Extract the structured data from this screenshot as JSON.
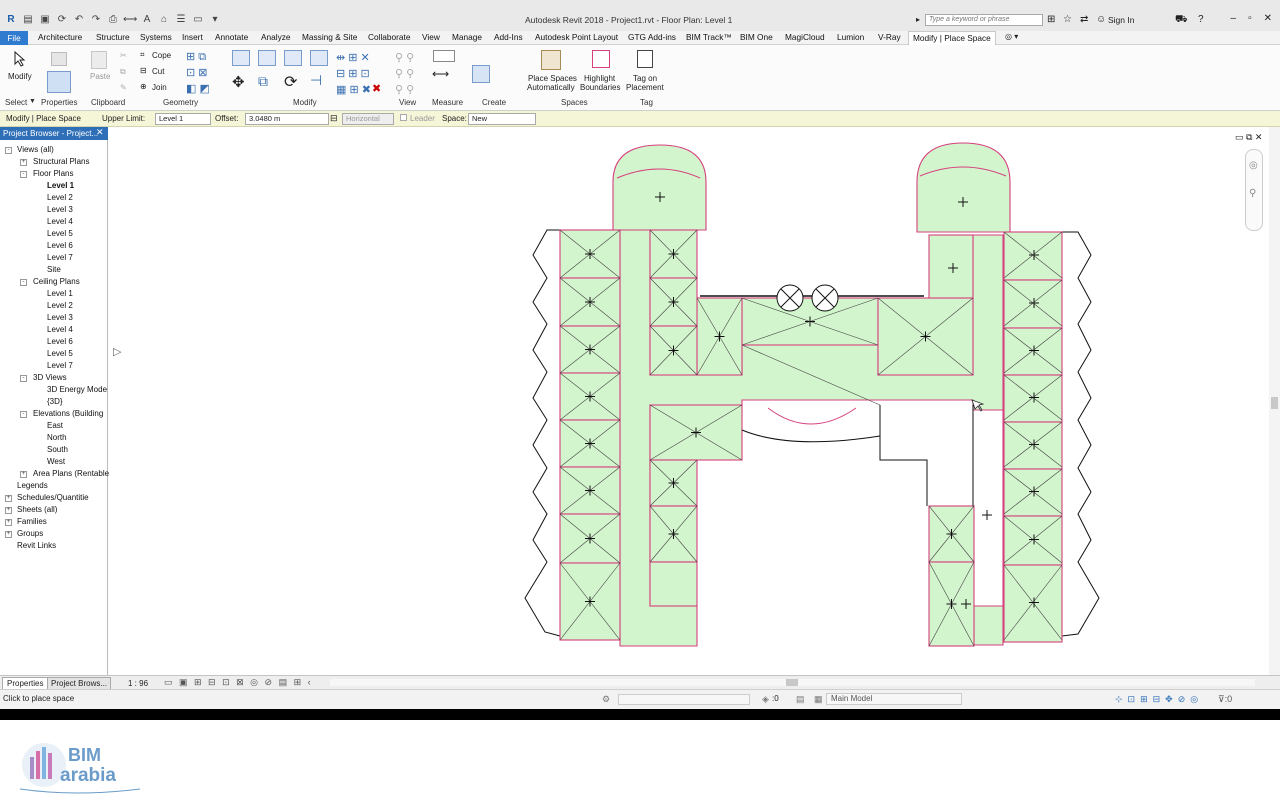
{
  "window": {
    "title": "Autodesk Revit 2018 -    Project1.rvt - Floor Plan: Level 1",
    "search_placeholder": "Type a keyword or phrase",
    "sign_in": "Sign In"
  },
  "tabs": [
    "File",
    "Architecture",
    "Structure",
    "Systems",
    "Insert",
    "Annotate",
    "Analyze",
    "Massing & Site",
    "Collaborate",
    "View",
    "Manage",
    "Add-Ins",
    "Autodesk Point Layout",
    "GTG Add-ins",
    "BIM Track™",
    "BIM One",
    "MagiCloud",
    "Lumion",
    "V-Ray",
    "Modify | Place Space"
  ],
  "ribbon": {
    "modify": "Modify",
    "paste": "Paste",
    "cope": "Cope",
    "cut": "Cut",
    "join": "Join",
    "place_spaces": "Place Spaces",
    "automatically": "Automatically",
    "highlight": "Highlight",
    "boundaries": "Boundaries",
    "tag_on": "Tag on",
    "placement": "Placement",
    "panels": [
      "Select",
      "Properties",
      "Clipboard",
      "Geometry",
      "Modify",
      "View",
      "Measure",
      "Create",
      "Spaces",
      "Tag"
    ]
  },
  "options_bar": {
    "context": "Modify | Place Space",
    "upper_limit_label": "Upper Limit:",
    "upper_limit_value": "Level 1",
    "offset_label": "Offset:",
    "offset_value": "3.0480 m",
    "orientation": "Horizontal",
    "leader": "Leader",
    "space_label": "Space:",
    "space_value": "New"
  },
  "browser": {
    "title": "Project Browser - Project...",
    "items": [
      {
        "label": "Views (all)",
        "level": 0,
        "exp": "-"
      },
      {
        "label": "Structural Plans",
        "level": 1,
        "exp": "+"
      },
      {
        "label": "Floor Plans",
        "level": 1,
        "exp": "-"
      },
      {
        "label": "Level 1",
        "level": 2,
        "bold": true
      },
      {
        "label": "Level 2",
        "level": 2
      },
      {
        "label": "Level 3",
        "level": 2
      },
      {
        "label": "Level 4",
        "level": 2
      },
      {
        "label": "Level 5",
        "level": 2
      },
      {
        "label": "Level 6",
        "level": 2
      },
      {
        "label": "Level 7",
        "level": 2
      },
      {
        "label": "Site",
        "level": 2
      },
      {
        "label": "Ceiling Plans",
        "level": 1,
        "exp": "-"
      },
      {
        "label": "Level 1",
        "level": 2
      },
      {
        "label": "Level 2",
        "level": 2
      },
      {
        "label": "Level 3",
        "level": 2
      },
      {
        "label": "Level 4",
        "level": 2
      },
      {
        "label": "Level 6",
        "level": 2
      },
      {
        "label": "Level 5",
        "level": 2
      },
      {
        "label": "Level 7",
        "level": 2
      },
      {
        "label": "3D Views",
        "level": 1,
        "exp": "-"
      },
      {
        "label": "3D Energy Mode",
        "level": 2
      },
      {
        "label": "{3D}",
        "level": 2
      },
      {
        "label": "Elevations (Building",
        "level": 1,
        "exp": "-"
      },
      {
        "label": "East",
        "level": 2
      },
      {
        "label": "North",
        "level": 2
      },
      {
        "label": "South",
        "level": 2
      },
      {
        "label": "West",
        "level": 2
      },
      {
        "label": "Area Plans (Rentable",
        "level": 1,
        "exp": "+"
      },
      {
        "label": "Legends",
        "level": 0
      },
      {
        "label": "Schedules/Quantitie",
        "level": 0,
        "exp": "+"
      },
      {
        "label": "Sheets (all)",
        "level": 0,
        "exp": "+"
      },
      {
        "label": "Families",
        "level": 0,
        "exp": "+"
      },
      {
        "label": "Groups",
        "level": 0,
        "exp": "+"
      },
      {
        "label": "Revit Links",
        "level": 0
      }
    ]
  },
  "bottom": {
    "properties_tab": "Properties",
    "browser_tab": "Project Brows...",
    "scale": "1 : 96"
  },
  "status": {
    "message": "Click to place space",
    "zero": ":0",
    "model": "Main Model"
  },
  "logo": {
    "line1": "BIM",
    "line2": "arabia"
  },
  "colors": {
    "space_fill": "#d3f5cd",
    "boundary": "#d6407e",
    "file_tab": "#2e7bcf",
    "options_bar": "#f5f5d8"
  }
}
